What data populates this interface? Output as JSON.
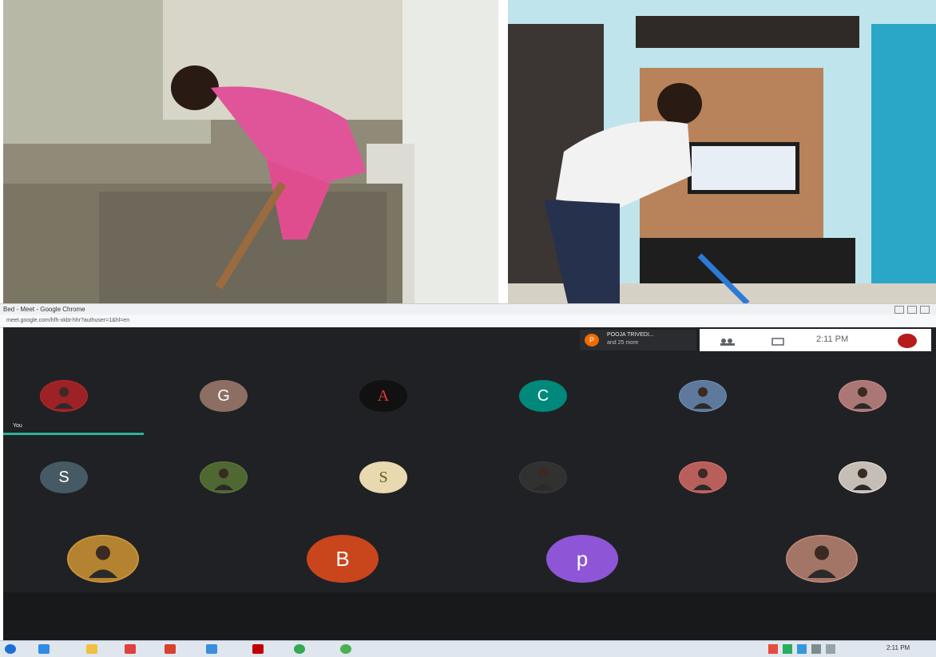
{
  "browser": {
    "title": "Bed - Meet - Google Chrome",
    "url": "meet.google.com/hfh-xkbt-hhr?authuser=1&hl=en"
  },
  "meet": {
    "presenter_name": "POOJA TRIVEDI...",
    "presenter_sub": "and 25 more",
    "presenter_initial": "P",
    "clock_time": "2:11 PM",
    "you_label": "You",
    "participants_row1": [
      {
        "kind": "photo",
        "color": "#b8282c"
      },
      {
        "kind": "letter",
        "letter": "G",
        "color": "#8d6e63"
      },
      {
        "kind": "letter",
        "letter": "A",
        "color": "#e53935"
      },
      {
        "kind": "letter",
        "letter": "C",
        "color": "#00897b"
      },
      {
        "kind": "photo",
        "color": "#6f8fb8"
      },
      {
        "kind": "photo",
        "color": "#c98b8b"
      }
    ],
    "participants_row2": [
      {
        "kind": "letter",
        "letter": "S",
        "color": "#455a64"
      },
      {
        "kind": "photo",
        "color": "#5d7a3a"
      },
      {
        "kind": "letter",
        "letter": "S",
        "color": "#e8d9b0"
      },
      {
        "kind": "photo",
        "color": "#3a3a3a"
      },
      {
        "kind": "photo",
        "color": "#d9706b"
      },
      {
        "kind": "photo",
        "color": "#e8e0d8"
      }
    ],
    "participants_row3": [
      {
        "kind": "photo",
        "color": "#d49a3a"
      },
      {
        "kind": "letter",
        "letter": "B",
        "color": "#c9451c"
      },
      {
        "kind": "letter",
        "letter": "p",
        "color": "#8e56d6"
      },
      {
        "kind": "photo",
        "color": "#c08a78"
      }
    ]
  },
  "taskbar": {
    "tray_time": "2:11 PM"
  }
}
